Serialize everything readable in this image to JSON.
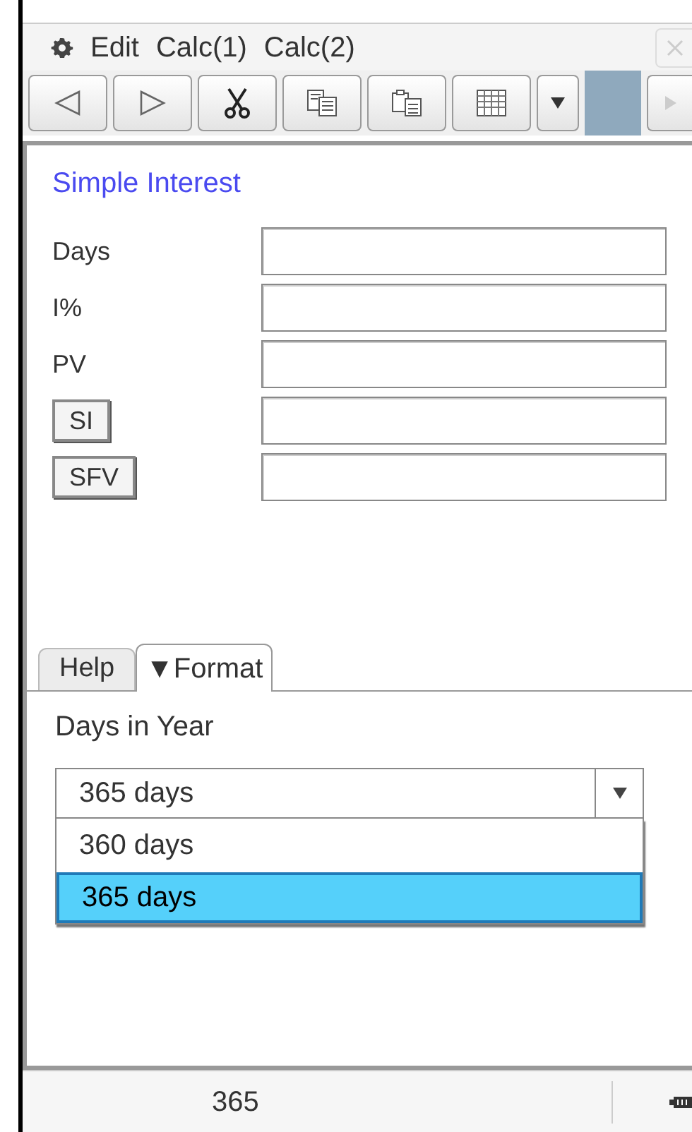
{
  "menu": [
    "Edit",
    "Calc(1)",
    "Calc(2)"
  ],
  "form": {
    "title": "Simple Interest",
    "rows": [
      {
        "kind": "label",
        "label": "Days"
      },
      {
        "kind": "label",
        "label": "I%"
      },
      {
        "kind": "label",
        "label": "PV"
      },
      {
        "kind": "button",
        "label": "SI"
      },
      {
        "kind": "button",
        "label": "SFV"
      }
    ]
  },
  "tabs": [
    {
      "label": "Help",
      "selected": false
    },
    {
      "label": "▼Format",
      "selected": true
    }
  ],
  "format": {
    "label": "Days in Year",
    "dropdown": {
      "value": "365 days",
      "options": [
        {
          "label": "360 days",
          "selected": false
        },
        {
          "label": "365 days",
          "selected": true
        }
      ]
    }
  },
  "status_bar": {
    "value": "365"
  }
}
